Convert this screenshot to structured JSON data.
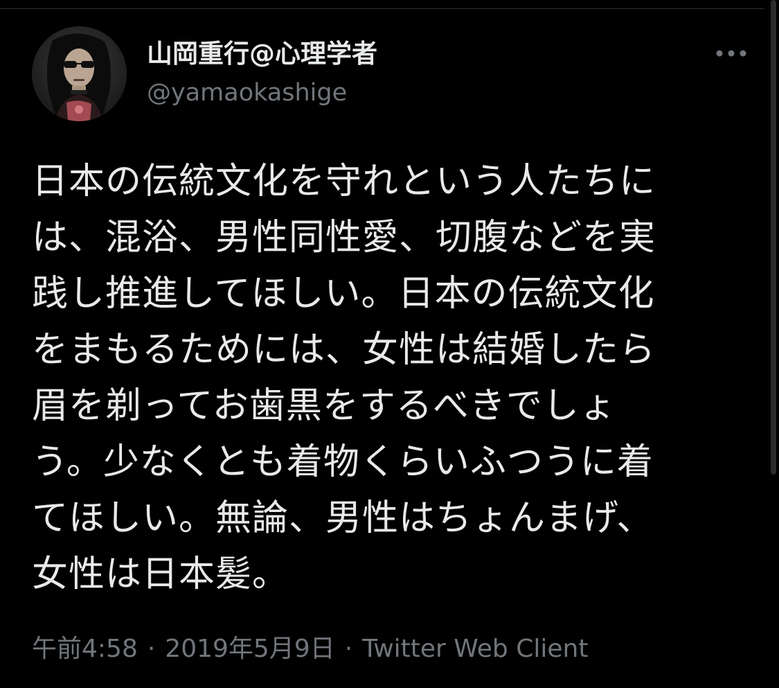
{
  "tweet": {
    "author": {
      "display_name": "山岡重行@心理学者",
      "handle": "@yamaokashige",
      "avatar_icon": "avatar-photo"
    },
    "more_icon": "more-horizontal-icon",
    "text": "日本の伝統文化を守れという人たちに\nは、混浴、男性同性愛、切腹などを実\n践し推進してほしい。日本の伝統文化\nをまもるためには、女性は結婚したら\n眉を剃ってお歯黒をするべきでしょ\nう。少なくとも着物くらいふつうに着\nてほしい。無論、男性はちょんまげ、\n女性は日本髪。",
    "time": "午前4:58",
    "separator_1": "·",
    "date": "2019年5月9日",
    "separator_2": "·",
    "client": "Twitter Web Client"
  },
  "colors": {
    "background": "#000000",
    "primary_text": "#e7e9ea",
    "secondary_text": "#71767b",
    "divider": "#2f3336"
  }
}
